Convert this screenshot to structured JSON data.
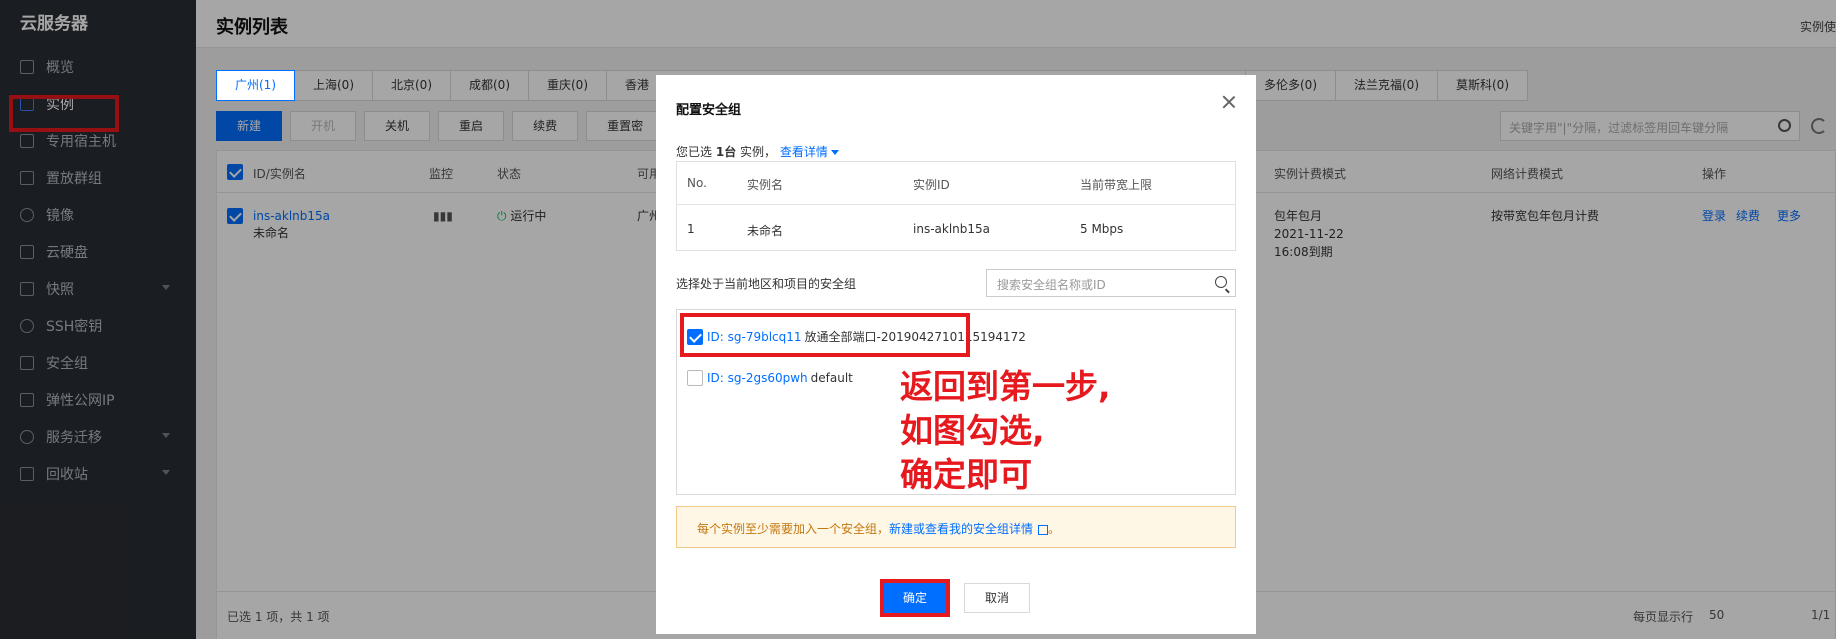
{
  "sidebar": {
    "logo": "云服务器",
    "items": [
      {
        "label": "概览",
        "icon": "grid-icon"
      },
      {
        "label": "实例",
        "icon": "cube-icon",
        "active": true
      },
      {
        "label": "专用宿主机",
        "icon": "layers-icon"
      },
      {
        "label": "置放群组",
        "icon": "hexagon-icon"
      },
      {
        "label": "镜像",
        "icon": "disc-icon"
      },
      {
        "label": "云硬盘",
        "icon": "disk-icon"
      },
      {
        "label": "快照",
        "icon": "camera-icon",
        "has_caret": true
      },
      {
        "label": "SSH密钥",
        "icon": "key-icon"
      },
      {
        "label": "安全组",
        "icon": "shield-icon"
      },
      {
        "label": "弹性公网IP",
        "icon": "ip-icon"
      },
      {
        "label": "服务迁移",
        "icon": "migrate-icon",
        "has_caret": true
      },
      {
        "label": "回收站",
        "icon": "trash-icon",
        "has_caret": true
      }
    ]
  },
  "header": {
    "title": "实例列表",
    "right_text": "实例使"
  },
  "regions": [
    "广州(1)",
    "上海(0)",
    "北京(0)",
    "成都(0)",
    "重庆(0)",
    "香港",
    "多伦多(0)",
    "法兰克福(0)",
    "莫斯科(0)"
  ],
  "toolbar": {
    "buttons": [
      "新建",
      "开机",
      "关机",
      "重启",
      "续费",
      "重置密"
    ],
    "search_placeholder": "关键字用\"|\"分隔，过滤标签用回车键分隔"
  },
  "table": {
    "headers": {
      "id": "ID/实例名",
      "monitor": "监控",
      "status": "状态",
      "avail": "可用",
      "billing": "实例计费模式",
      "net_billing": "网络计费模式",
      "ops": "操作"
    },
    "row": {
      "id": "ins-aklnb15a",
      "name": "未命名",
      "status": "运行中",
      "zone": "广州",
      "billing_mode": "包年包月",
      "expire_date": "2021-11-22",
      "expire_time": "16:08到期",
      "net_billing": "按带宽包年包月计费",
      "op_login": "登录",
      "op_renew": "续费",
      "op_more": "更多"
    },
    "footer": {
      "selected": "已选 1 项，共 1 项",
      "page_size_label": "每页显示行",
      "page_size": "50",
      "page": "1/1"
    }
  },
  "modal": {
    "title": "配置安全组",
    "selected_prefix": "您已选",
    "selected_count": "1台",
    "selected_suffix": "实例，",
    "detail_link": "查看详情",
    "inner_headers": {
      "no": "No.",
      "name": "实例名",
      "id": "实例ID",
      "bandwidth": "当前带宽上限"
    },
    "inner_row": {
      "no": "1",
      "name": "未命名",
      "id": "ins-aklnb15a",
      "bandwidth": "5 Mbps"
    },
    "sg_label": "选择处于当前地区和项目的安全组",
    "sg_search_placeholder": "搜索安全组名称或ID",
    "security_groups": [
      {
        "id": "ID: sg-79blcq11",
        "name": "放通全部端口-2019042710115194172",
        "checked": true
      },
      {
        "id": "ID: sg-2gs60pwh",
        "name": "default",
        "checked": false
      }
    ],
    "annotation": [
      "返回到第一步,",
      "如图勾选,",
      "确定即可"
    ],
    "tip_text": "每个实例至少需要加入一个安全组，",
    "tip_link": "新建或查看我的安全组详情",
    "tip_end": "。",
    "confirm": "确定",
    "cancel": "取消"
  },
  "colors": {
    "accent": "#006eff",
    "annotation_red": "#e6191e",
    "sidebar_bg": "#292d33"
  }
}
